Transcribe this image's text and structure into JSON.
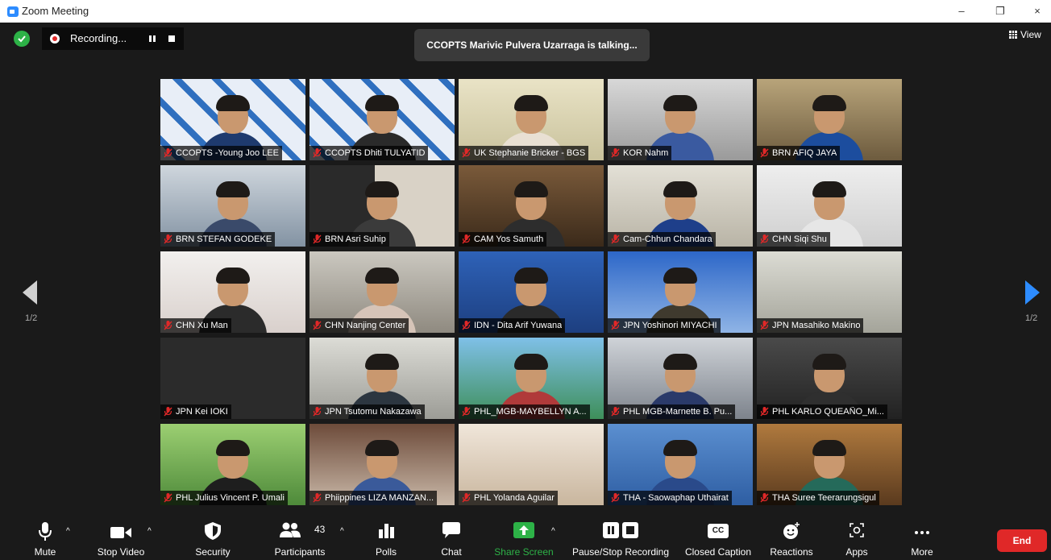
{
  "window": {
    "title": "Zoom Meeting",
    "minimize": "–",
    "restore": "❐",
    "close": "×"
  },
  "top": {
    "recording_label": "Recording...",
    "talking": "CCOPTS Marivic Pulvera Uzarraga is talking...",
    "view_label": "View"
  },
  "pager": {
    "left_page": "1/2",
    "right_page": "1/2"
  },
  "participants": [
    "CCOPTS -Young Joo LEE",
    "CCOPTS Dhiti TULYATID",
    "UK Stephanie Bricker - BGS",
    "KOR Nahm",
    "BRN AFIQ JAYA",
    "BRN STEFAN GODEKE",
    "BRN Asri Suhip",
    "CAM Yos Samuth",
    "Cam-Chhun Chandara",
    "CHN Siqi Shu",
    "CHN Xu Man",
    "CHN Nanjing Center",
    "IDN - Dita Arif Yuwana",
    "JPN Yoshinori MIYACHI",
    "JPN Masahiko Makino",
    "JPN Kei IOKI",
    "JPN Tsutomu Nakazawa",
    "PHL_MGB-MAYBELLYN A...",
    "PHL MGB-Marnette B. Pu...",
    "PHL KARLO QUEAÑO_Mi...",
    "PHL Julius Vincent P. Umali",
    "Phiippines LIZA MANZAN...",
    "PHL Yolanda Aguilar",
    "THA - Saowaphap Uthairat",
    "THA Suree Teerarungsigul"
  ],
  "toolbar": {
    "mute": "Mute",
    "stop_video": "Stop Video",
    "security": "Security",
    "participants": "Participants",
    "participants_count": "43",
    "polls": "Polls",
    "chat": "Chat",
    "share_screen": "Share Screen",
    "pause_recording": "Pause/Stop Recording",
    "closed_caption": "Closed Caption",
    "cc_badge": "CC",
    "reactions": "Reactions",
    "apps": "Apps",
    "more": "More",
    "end": "End"
  },
  "colors": {
    "share_green": "#2db247",
    "end_red": "#e02828",
    "mute_red": "#e02828",
    "nav_blue": "#2d8cff"
  }
}
